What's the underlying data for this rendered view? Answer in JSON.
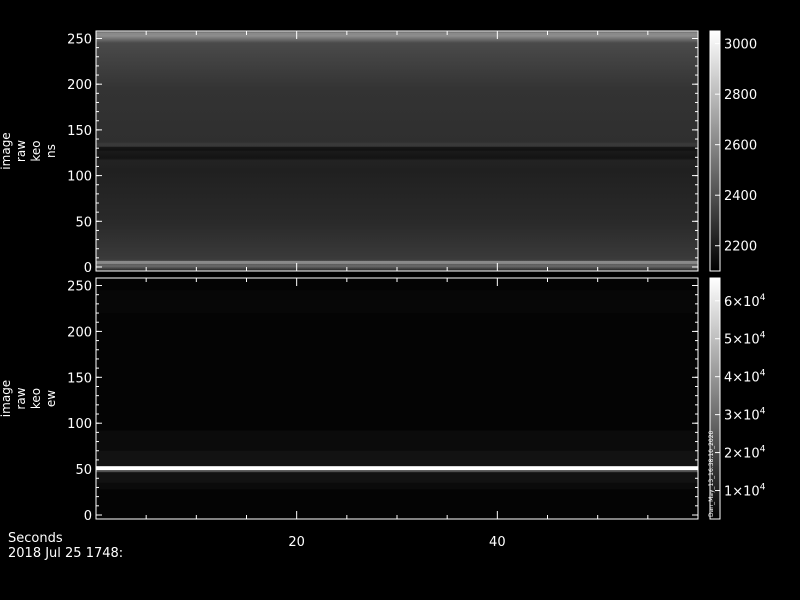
{
  "chart_data": [
    {
      "type": "heatmap",
      "ylabel": [
        "image",
        "raw",
        "keo",
        "ns"
      ],
      "ylim": [
        0,
        256
      ],
      "yticks": [
        0,
        50,
        100,
        150,
        200,
        250
      ],
      "xlim": [
        0,
        60
      ],
      "colorbar": {
        "range": [
          2100,
          3050
        ],
        "ticks": [
          "2200",
          "2400",
          "2600",
          "2800",
          "3000"
        ]
      },
      "colormap": "grayscale",
      "features": {
        "dark_band_rows": 125,
        "bright_edge_rows": [
          5,
          255
        ]
      }
    },
    {
      "type": "heatmap",
      "ylabel": [
        "image",
        "raw",
        "keo",
        "ew"
      ],
      "ylim": [
        0,
        256
      ],
      "yticks": [
        0,
        50,
        100,
        150,
        200,
        250
      ],
      "xlim": [
        0,
        60
      ],
      "xticks": [
        20,
        40
      ],
      "colorbar": {
        "range": [
          2500,
          66000
        ],
        "ticks": [
          {
            "mantissa": "1",
            "exp": "4"
          },
          {
            "mantissa": "2",
            "exp": "4"
          },
          {
            "mantissa": "3",
            "exp": "4"
          },
          {
            "mantissa": "4",
            "exp": "4"
          },
          {
            "mantissa": "5",
            "exp": "4"
          },
          {
            "mantissa": "6",
            "exp": "4"
          }
        ],
        "tick_values": [
          10000,
          20000,
          30000,
          40000,
          50000,
          60000
        ],
        "side_label": "Dan_May_13_16:38:10_2020"
      },
      "colormap": "grayscale",
      "features": {
        "bright_line_row": 51
      }
    }
  ],
  "footer": {
    "xaxis_label": "Seconds",
    "date": "2018 Jul 25 1748:"
  },
  "colors": {
    "background": "#000000",
    "foreground": "#ffffff"
  }
}
